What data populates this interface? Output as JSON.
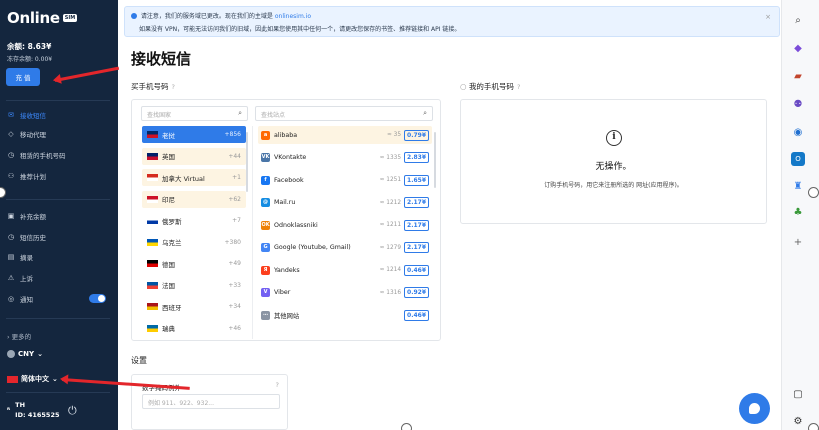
{
  "sidebar": {
    "logo_word": "Online",
    "logo_badge": "SIM",
    "balance": "余额: 8.63¥",
    "frozen_balance": "冻存余额: 0.00¥",
    "topup_label": "充 值",
    "nav": [
      {
        "label": "接收短信",
        "icon": "✉",
        "active": true
      },
      {
        "label": "移动代理",
        "icon": "◇"
      },
      {
        "label": "租赁的手机号码",
        "icon": "◷"
      },
      {
        "label": "推荐计划",
        "icon": "⚇"
      }
    ],
    "nav2": [
      {
        "label": "补充余额",
        "icon": "▣"
      },
      {
        "label": "短信历史",
        "icon": "◷"
      },
      {
        "label": "摘录",
        "icon": "▤"
      },
      {
        "label": "上诉",
        "icon": "⚠"
      },
      {
        "label": "通知",
        "icon": "◎"
      }
    ],
    "more_label": "更多的",
    "currency": "CNY",
    "language": "简体中文",
    "user_initial": "TH",
    "user_id": "ID: 4165525"
  },
  "notice": {
    "line1_prefix": "请注意，我们的服务域已更改。现在我们的主域是",
    "domain": "onlinesim.io",
    "line2": "如果没有 VPN，可能无法访问我们的旧域，因此如果您使用其中任何一个，请更改您保存的书签、推荐链接和 API 链接。",
    "close": "×"
  },
  "page_title": "接收短信",
  "buy_section": "买手机号码",
  "mine_section": "我的手机号码",
  "help_mark": "?",
  "country_search_placeholder": "查找国家",
  "service_search_placeholder": "查找站点",
  "countries": [
    {
      "name": "老挝",
      "code": "+856",
      "colors": [
        "#002868",
        "#ce1126"
      ],
      "state": "active"
    },
    {
      "name": "英国",
      "code": "+44",
      "colors": [
        "#012169",
        "#c8102e"
      ],
      "state": "soft"
    },
    {
      "name": "加拿大 Virtual",
      "code": "+1",
      "colors": [
        "#d52b1e",
        "#ffffff"
      ],
      "state": "soft"
    },
    {
      "name": "印尼",
      "code": "+62",
      "colors": [
        "#ce1126",
        "#ffffff"
      ],
      "state": "soft"
    },
    {
      "name": "俄罗斯",
      "code": "+7",
      "colors": [
        "#ffffff",
        "#0039a6"
      ],
      "state": ""
    },
    {
      "name": "乌克兰",
      "code": "+380",
      "colors": [
        "#0057b7",
        "#ffd700"
      ],
      "state": ""
    },
    {
      "name": "德国",
      "code": "+49",
      "colors": [
        "#000000",
        "#dd0000"
      ],
      "state": ""
    },
    {
      "name": "法国",
      "code": "+33",
      "colors": [
        "#0055a4",
        "#ef4135"
      ],
      "state": ""
    },
    {
      "name": "西班牙",
      "code": "+34",
      "colors": [
        "#aa151b",
        "#f1bf00"
      ],
      "state": ""
    },
    {
      "name": "瑞典",
      "code": "+46",
      "colors": [
        "#006aa7",
        "#fecc00"
      ],
      "state": ""
    }
  ],
  "services": [
    {
      "name": "alibaba",
      "count": "≈ 35",
      "price": "0.79¥",
      "icon_color": "#ff6a00",
      "icon_char": "a",
      "soft": true
    },
    {
      "name": "VKontakte",
      "count": "≈ 1335",
      "price": "2.83¥",
      "icon_color": "#4a76a8",
      "icon_char": "VK"
    },
    {
      "name": "Facebook",
      "count": "≈ 1251",
      "price": "1.65¥",
      "icon_color": "#1877f2",
      "icon_char": "f"
    },
    {
      "name": "Mail.ru",
      "count": "≈ 1212",
      "price": "2.17¥",
      "icon_color": "#168de2",
      "icon_char": "@"
    },
    {
      "name": "Odnoklassniki",
      "count": "≈ 1211",
      "price": "2.17¥",
      "icon_color": "#ee8208",
      "icon_char": "OK"
    },
    {
      "name": "Google (Youtube, Gmail)",
      "count": "≈ 1279",
      "price": "2.17¥",
      "icon_color": "#4285f4",
      "icon_char": "G"
    },
    {
      "name": "Yandeks",
      "count": "≈ 1214",
      "price": "0.46¥",
      "icon_color": "#fc3f1d",
      "icon_char": "Я"
    },
    {
      "name": "Viber",
      "count": "≈ 1316",
      "price": "0.92¥",
      "icon_color": "#7360f2",
      "icon_char": "V"
    },
    {
      "name": "其他网站",
      "count": "",
      "price": "0.46¥",
      "icon_color": "#8a94a3",
      "icon_char": "⋯"
    }
  ],
  "mine_empty_title": "无操作。",
  "mine_empty_hint": "订购手机号码，用它来注册所选的 网址(应用程序)。",
  "settings": {
    "title": "设置",
    "field_label": "数字掩码例外",
    "field_placeholder": "例如 911、922、932..."
  },
  "accent_color": "#2f7be8",
  "annotation_color": "#e3262b"
}
